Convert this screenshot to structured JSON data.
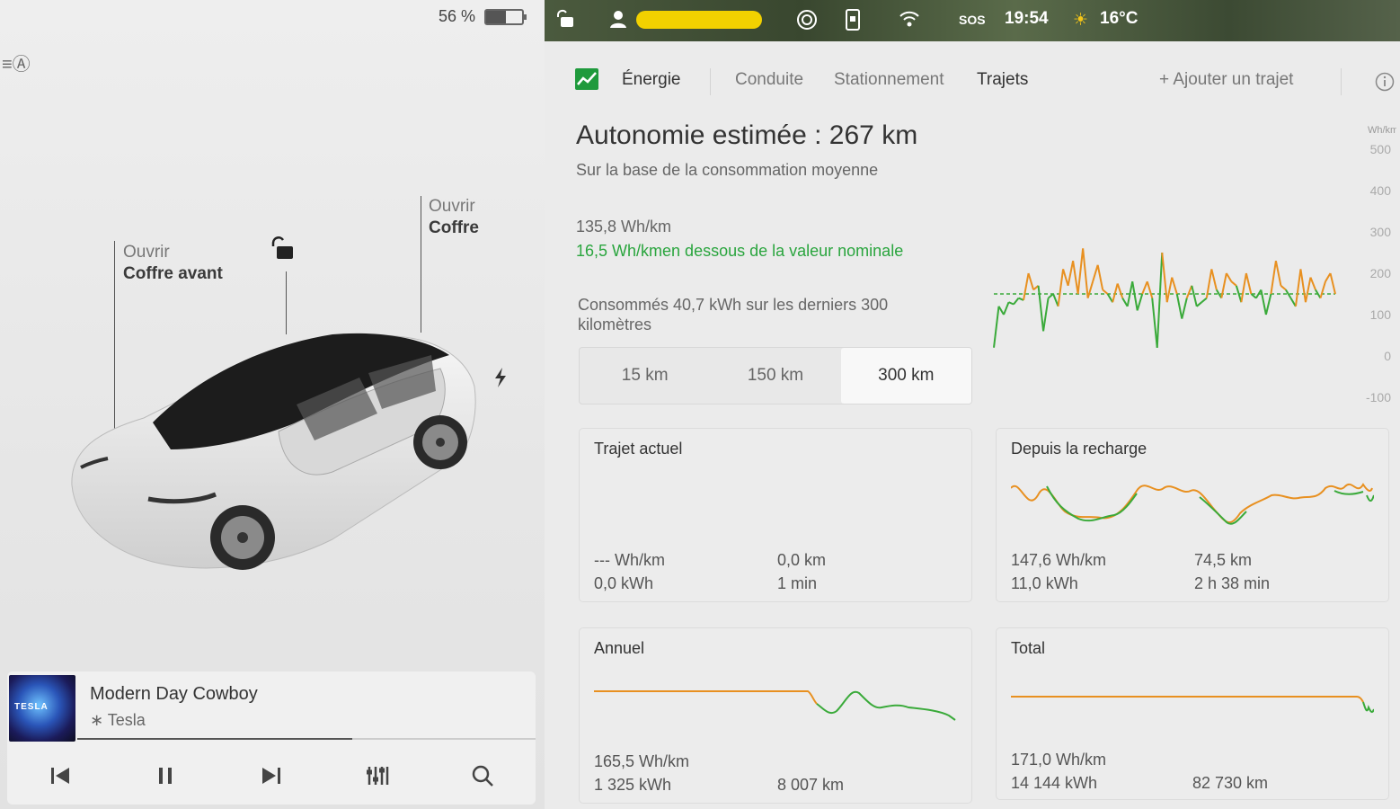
{
  "status": {
    "battery_percent_label": "56 %",
    "battery_level": 0.56,
    "time": "19:54",
    "temperature": "16°C",
    "sos": "SOS"
  },
  "car": {
    "frunk_line1": "Ouvrir",
    "frunk_line2": "Coffre avant",
    "trunk_line1": "Ouvrir",
    "trunk_line2": "Coffre"
  },
  "media": {
    "song_title": "Modern Day Cowboy",
    "source": "Tesla",
    "album_art_text": "TESLA",
    "progress": 0.6
  },
  "tabs": {
    "energy": "Énergie",
    "driving": "Conduite",
    "parking": "Stationnement",
    "trips": "Trajets",
    "add_trip": "+ Ajouter un trajet"
  },
  "energy": {
    "range_title": "Autonomie estimée : 267 km",
    "range_subtitle": "Sur la base de la consommation moyenne",
    "avg_consumption": "135,8 Wh/km",
    "diff_text": "16,5 Wh/kmen dessous de la valeur nominale",
    "consumed_text": "Consommés 40,7 kWh sur les derniers 300 kilomètres",
    "segments": [
      "15 km",
      "150 km",
      "300 km"
    ],
    "selected_segment": 2
  },
  "chart_data": {
    "type": "line",
    "ylabel": "Wh/km",
    "ylim": [
      -100,
      500
    ],
    "yticks": [
      "500",
      "400",
      "300",
      "200",
      "100",
      "0",
      "-100"
    ],
    "reference_line": 150,
    "series": [
      {
        "values": [
          20,
          120,
          100,
          130,
          125,
          140,
          135,
          200,
          160,
          170,
          60,
          140,
          150,
          120,
          210,
          170,
          230,
          150,
          260,
          140,
          180,
          220,
          160,
          150,
          130,
          175,
          140,
          120,
          180,
          110,
          150,
          180,
          140,
          20,
          250,
          130,
          190,
          150,
          90,
          140,
          170,
          120,
          130,
          140,
          210,
          160,
          140,
          200,
          180,
          170,
          130,
          200,
          150,
          140,
          160,
          100,
          150,
          230,
          170,
          160,
          140,
          120,
          210,
          130,
          190,
          160,
          140,
          180,
          200,
          150
        ],
        "colors": {
          "above": "#e89020",
          "below": "#3aaa3a"
        }
      }
    ]
  },
  "cards": {
    "current_trip": {
      "title": "Trajet actuel",
      "consumption": "--- Wh/km",
      "energy": "0,0 kWh",
      "distance": "0,0 km",
      "duration": "1 min"
    },
    "since_charge": {
      "title": "Depuis la recharge",
      "consumption": "147,6 Wh/km",
      "energy": "11,0 kWh",
      "distance": "74,5 km",
      "duration": "2 h 38 min"
    },
    "annual": {
      "title": "Annuel",
      "consumption": "165,5 Wh/km",
      "energy": "1 325 kWh",
      "distance": "8 007 km"
    },
    "total": {
      "title": "Total",
      "consumption": "171,0 Wh/km",
      "energy": "14 144 kWh",
      "distance": "82 730 km"
    }
  },
  "colors": {
    "accent_green": "#2aa53e",
    "accent_orange": "#e89020",
    "status_yellow": "#f2d100"
  }
}
